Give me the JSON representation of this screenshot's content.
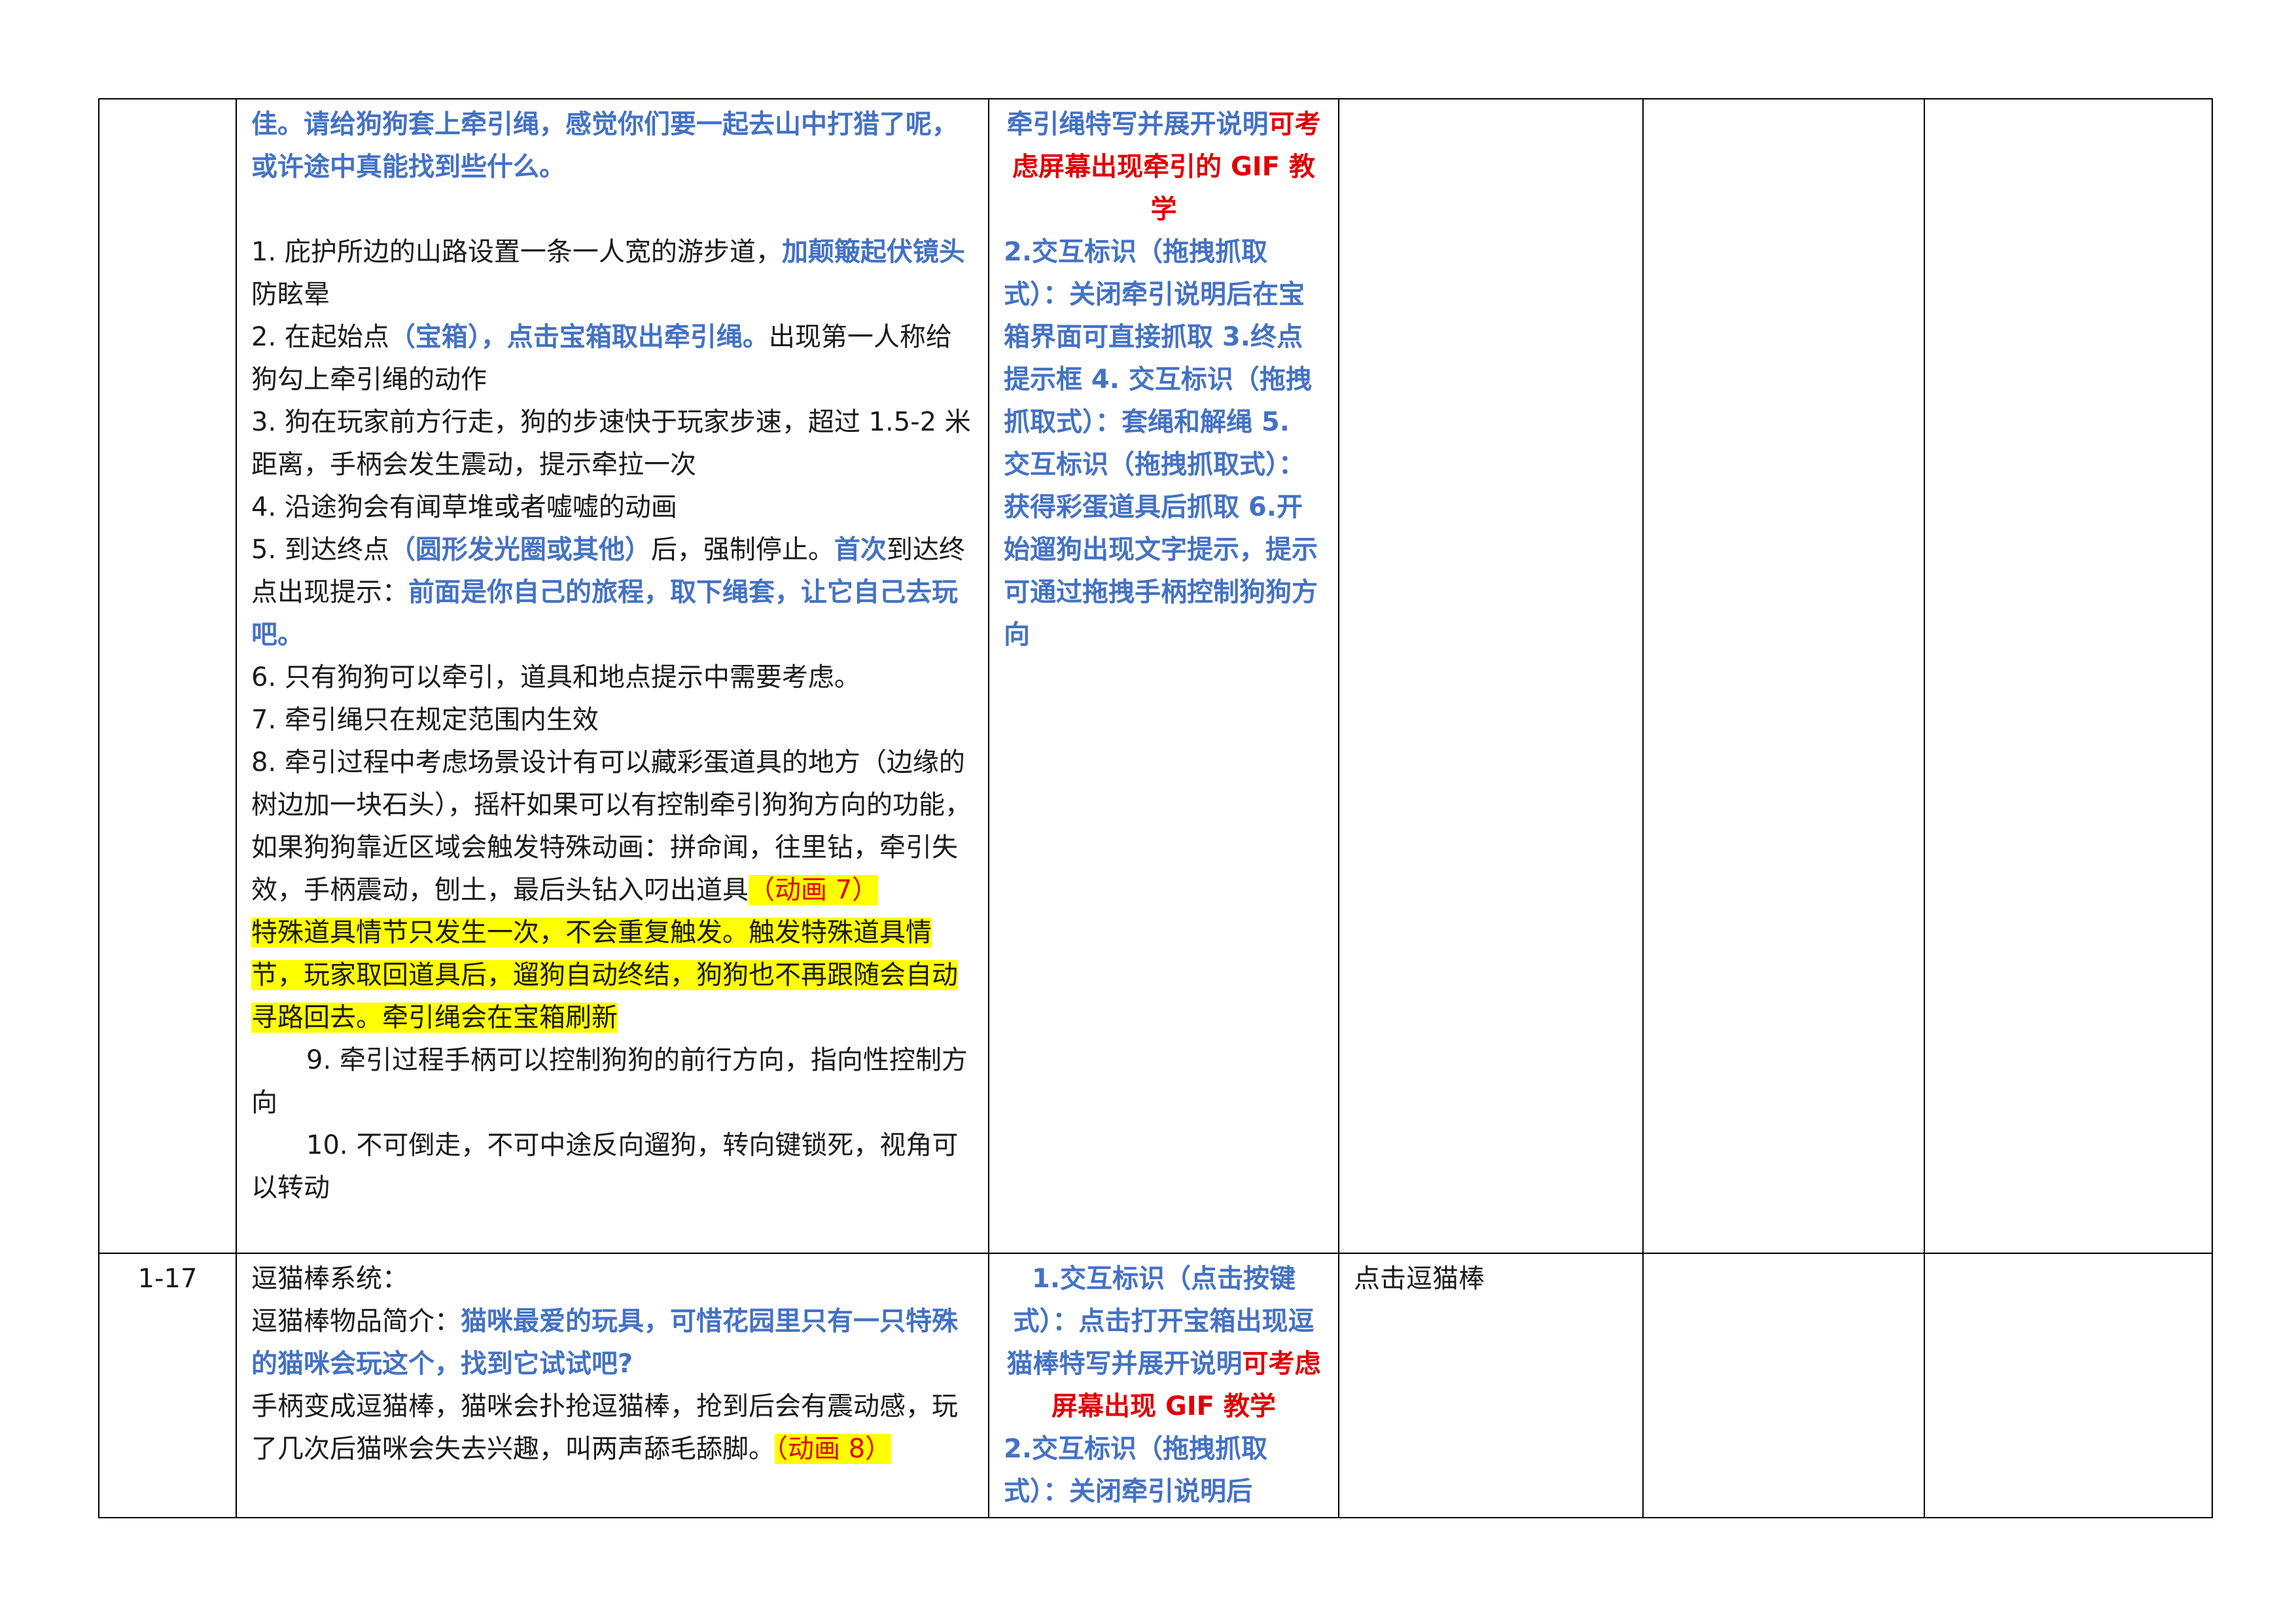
{
  "rows": [
    {
      "id": "",
      "desc": {
        "intro_blue": "佳。请给狗狗套上牵引绳，感觉你们要一起去山中打猎了呢，或许途中真能找到些什么。",
        "items": [
          {
            "a": "1. 庇护所边的山路设置一条一人宽的游步道，",
            "b": "加颠簸起伏镜头",
            "c": "防眩晕"
          },
          {
            "a": "2. 在起始点",
            "b": "（宝箱），点击宝箱取出牵引绳。",
            "c": "出现第一人称给狗勾上牵引绳的动作"
          },
          {
            "a": "3. 狗在玩家前方行走，狗的步速快于玩家步速，超过 1.5-2 米距离，手柄会发生震动，提示牵拉一次"
          },
          {
            "a": "4. 沿途狗会有闻草堆或者嘘嘘的动画"
          },
          {
            "a": "5. 到达终点",
            "b": "（圆形发光圈或其他）",
            "c": "后，强制停止。",
            "d": "首次",
            "e": "到达终点出现提示：",
            "f": "前面是你自己的旅程，取下绳套，让它自己去玩吧。"
          },
          {
            "a": "6. 只有狗狗可以牵引，道具和地点提示中需要考虑。"
          },
          {
            "a": "7. 牵引绳只在规定范围内生效"
          },
          {
            "a": "8. 牵引过程中考虑场景设计有可以藏彩蛋道具的地方（边缘的树边加一块石头），摇杆如果可以有控制牵引狗狗方向的功能，如果狗狗靠近区域会触发特殊动画：拼命闻，往里钻，牵引失效，手柄震动，刨土，最后头钻入叼出道具",
            "hl": "（动画 7）"
          }
        ],
        "highlight_para": "特殊道具情节只发生一次，不会重复触发。触发特殊道具情节，玩家取回道具后，遛狗自动终结，狗狗也不再跟随会自动寻路回去。牵引绳会在宝箱刷新",
        "item9": "9. 牵引过程手柄可以控制狗狗的前行方向，指向性控制方向",
        "item10": "10. 不可倒走，不可中途反向遛狗，转向键锁死，视角可以转动"
      },
      "interaction": {
        "line1_blue": "牵引绳特写并展开说明",
        "line1_red": "可考虑屏幕出现牵引的 GIF 教学",
        "rest": "2.交互标识（拖拽抓取式）：关闭牵引说明后在宝箱界面可直接抓取 3.终点提示框 4. 交互标识（拖拽抓取式）：套绳和解绳 5. 交互标识（拖拽抓取式）：获得彩蛋道具后抓取 6.开始遛狗出现文字提示，提示可通过拖拽手柄控制狗狗方向"
      },
      "col4": "",
      "col5": "",
      "col6": ""
    },
    {
      "id": "1-17",
      "desc": {
        "title": "逗猫棒系统：",
        "intro_label": "逗猫棒物品简介：",
        "intro_blue": "猫咪最爱的玩具，可惜花园里只有一只特殊的猫咪会玩这个，找到它试试吧?",
        "body": "手柄变成逗猫棒，猫咪会扑抢逗猫棒，抢到后会有震动感，玩了几次后猫咪会失去兴趣，叫两声舔毛舔脚。",
        "hl": "（动画 8）"
      },
      "interaction": {
        "line1_blue": "1.交互标识（点击按键式）：点击打开宝箱出现逗猫棒特写并展开说明",
        "line1_red": "可考虑屏幕出现 GIF 教学",
        "rest": "2.交互标识（拖拽抓取式）：关闭牵引说明后"
      },
      "col4": "点击逗猫棒",
      "col5": "",
      "col6": ""
    }
  ]
}
